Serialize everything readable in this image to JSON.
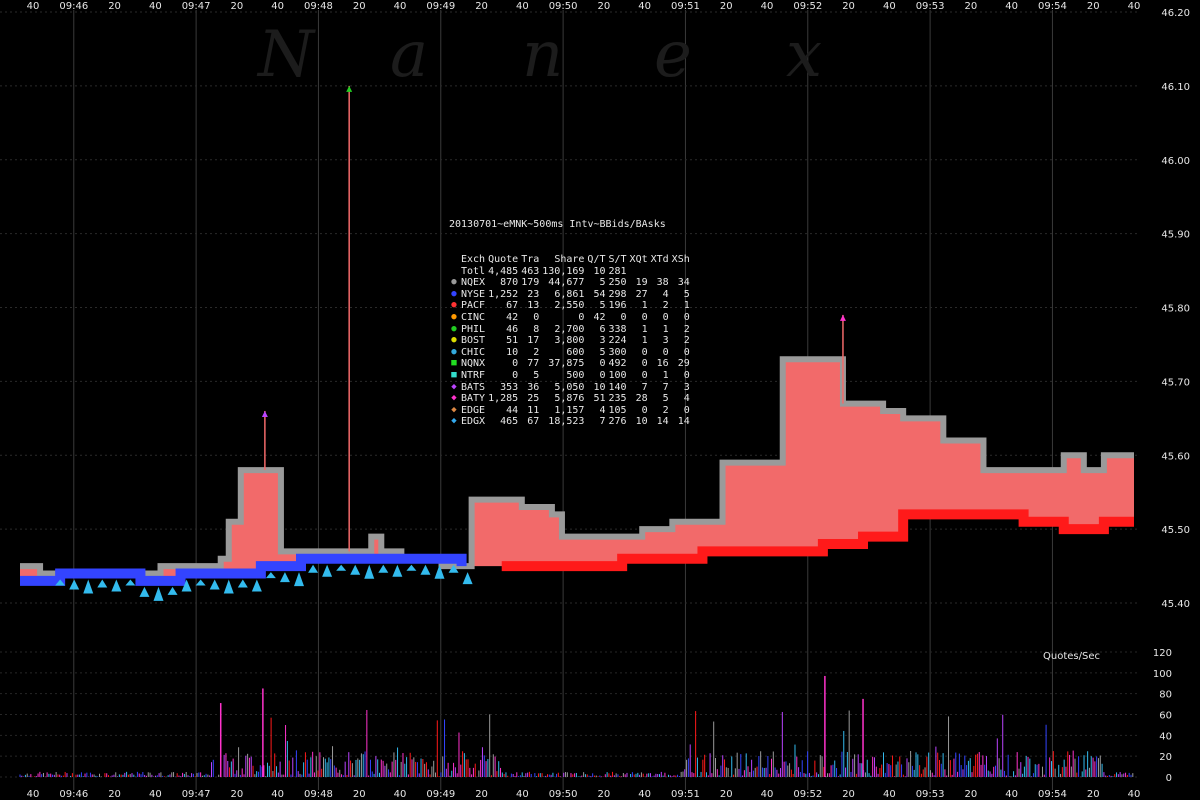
{
  "watermark": [
    "N",
    "a",
    "n",
    "e",
    "x"
  ],
  "top_axis_labels": [
    "40",
    "09:46",
    "20",
    "40",
    "09:47",
    "20",
    "40",
    "09:48",
    "20",
    "40",
    "09:49",
    "20",
    "40",
    "09:50",
    "20",
    "40",
    "09:51",
    "20",
    "40",
    "09:52",
    "20",
    "40",
    "09:53",
    "20",
    "40",
    "09:54",
    "20",
    "40"
  ],
  "bottom_axis_labels": [
    "40",
    "09:46",
    "20",
    "40",
    "09:47",
    "20",
    "40",
    "09:48",
    "20",
    "40",
    "09:49",
    "20",
    "40",
    "09:50",
    "20",
    "40",
    "09:51",
    "20",
    "40",
    "09:52",
    "20",
    "40",
    "09:53",
    "20",
    "40",
    "09:54",
    "20",
    "40"
  ],
  "stats": {
    "title": "20130701~eMNK~500ms Intv~BBids/BAsks",
    "headers": [
      "Exch",
      "Quote",
      "Tra",
      "Share",
      "Q/T",
      "S/T",
      "XQt",
      "XTd",
      "XSh"
    ],
    "rows": [
      {
        "sym": "",
        "color": "#e8e8e8",
        "cells": [
          "Totl",
          "4,485",
          "463",
          "130,169",
          "10",
          "281",
          "",
          "",
          ""
        ]
      },
      {
        "sym": "●",
        "color": "#9a9a9a",
        "cells": [
          "NQEX",
          "870",
          "179",
          "44,677",
          "5",
          "250",
          "19",
          "38",
          "34"
        ]
      },
      {
        "sym": "●",
        "color": "#3344ff",
        "cells": [
          "NYSE",
          "1,252",
          "23",
          "6,861",
          "54",
          "298",
          "27",
          "4",
          "5"
        ]
      },
      {
        "sym": "●",
        "color": "#ff3333",
        "cells": [
          "PACF",
          "67",
          "13",
          "2,550",
          "5",
          "196",
          "1",
          "2",
          "1"
        ]
      },
      {
        "sym": "●",
        "color": "#ff9900",
        "cells": [
          "CINC",
          "42",
          "0",
          "0",
          "42",
          "0",
          "0",
          "0",
          "0"
        ]
      },
      {
        "sym": "●",
        "color": "#22cc22",
        "cells": [
          "PHIL",
          "46",
          "8",
          "2,700",
          "6",
          "338",
          "1",
          "1",
          "2"
        ]
      },
      {
        "sym": "●",
        "color": "#dddd00",
        "cells": [
          "BOST",
          "51",
          "17",
          "3,800",
          "3",
          "224",
          "1",
          "3",
          "2"
        ]
      },
      {
        "sym": "●",
        "color": "#33aadd",
        "cells": [
          "CHIC",
          "10",
          "2",
          "600",
          "5",
          "300",
          "0",
          "0",
          "0"
        ]
      },
      {
        "sym": "■",
        "color": "#22dd22",
        "cells": [
          "NQNX",
          "0",
          "77",
          "37,875",
          "0",
          "492",
          "0",
          "16",
          "29"
        ]
      },
      {
        "sym": "■",
        "color": "#33ddcc",
        "cells": [
          "NTRF",
          "0",
          "5",
          "500",
          "0",
          "100",
          "0",
          "1",
          "0"
        ]
      },
      {
        "sym": "◆",
        "color": "#bb44ff",
        "cells": [
          "BATS",
          "353",
          "36",
          "5,050",
          "10",
          "140",
          "7",
          "7",
          "3"
        ]
      },
      {
        "sym": "◆",
        "color": "#ff33cc",
        "cells": [
          "BATY",
          "1,285",
          "25",
          "5,876",
          "51",
          "235",
          "28",
          "5",
          "4"
        ]
      },
      {
        "sym": "◆",
        "color": "#dd8844",
        "cells": [
          "EDGE",
          "44",
          "11",
          "1,157",
          "4",
          "105",
          "0",
          "2",
          "0"
        ]
      },
      {
        "sym": "◆",
        "color": "#33aaee",
        "cells": [
          "EDGX",
          "465",
          "67",
          "18,523",
          "7",
          "276",
          "10",
          "14",
          "14"
        ]
      }
    ]
  },
  "chart_data": [
    {
      "type": "area",
      "panel": "price",
      "ylim": [
        45.35,
        46.2
      ],
      "y_ticks": [
        "45.40",
        "45.50",
        "45.60",
        "45.70",
        "45.80",
        "45.90",
        "46.00",
        "46.10",
        "46.20"
      ],
      "y_tick_values": [
        45.4,
        45.5,
        45.6,
        45.7,
        45.8,
        45.9,
        46.0,
        46.1,
        46.2
      ],
      "xlim_seconds": [
        0,
        555
      ],
      "best_bid": [
        [
          0,
          45.43
        ],
        [
          10,
          45.43
        ],
        [
          20,
          45.44
        ],
        [
          40,
          45.44
        ],
        [
          60,
          45.43
        ],
        [
          80,
          45.44
        ],
        [
          100,
          45.44
        ],
        [
          120,
          45.45
        ],
        [
          140,
          45.46
        ],
        [
          160,
          45.46
        ],
        [
          180,
          45.46
        ],
        [
          200,
          45.46
        ],
        [
          220,
          45.45
        ],
        [
          240,
          45.45
        ],
        [
          260,
          45.45
        ],
        [
          280,
          45.45
        ],
        [
          300,
          45.46
        ],
        [
          320,
          45.46
        ],
        [
          340,
          45.47
        ],
        [
          360,
          45.47
        ],
        [
          380,
          45.47
        ],
        [
          400,
          45.48
        ],
        [
          420,
          45.49
        ],
        [
          440,
          45.52
        ],
        [
          460,
          45.52
        ],
        [
          480,
          45.52
        ],
        [
          500,
          45.51
        ],
        [
          520,
          45.5
        ],
        [
          540,
          45.51
        ],
        [
          555,
          45.51
        ]
      ],
      "best_ask": [
        [
          0,
          45.45
        ],
        [
          10,
          45.44
        ],
        [
          20,
          45.44
        ],
        [
          40,
          45.44
        ],
        [
          60,
          45.44
        ],
        [
          70,
          45.45
        ],
        [
          80,
          45.45
        ],
        [
          90,
          45.45
        ],
        [
          100,
          45.46
        ],
        [
          104,
          45.51
        ],
        [
          110,
          45.58
        ],
        [
          120,
          45.58
        ],
        [
          130,
          45.47
        ],
        [
          170,
          45.47
        ],
        [
          175,
          45.49
        ],
        [
          180,
          45.47
        ],
        [
          190,
          45.46
        ],
        [
          210,
          45.45
        ],
        [
          225,
          45.54
        ],
        [
          250,
          45.53
        ],
        [
          265,
          45.52
        ],
        [
          270,
          45.49
        ],
        [
          290,
          45.49
        ],
        [
          310,
          45.5
        ],
        [
          325,
          45.51
        ],
        [
          340,
          45.51
        ],
        [
          350,
          45.59
        ],
        [
          365,
          45.59
        ],
        [
          380,
          45.73
        ],
        [
          400,
          45.73
        ],
        [
          410,
          45.67
        ],
        [
          430,
          45.66
        ],
        [
          440,
          45.65
        ],
        [
          460,
          45.62
        ],
        [
          480,
          45.58
        ],
        [
          500,
          45.58
        ],
        [
          520,
          45.6
        ],
        [
          530,
          45.58
        ],
        [
          540,
          45.6
        ],
        [
          555,
          45.6
        ]
      ],
      "spikes": [
        {
          "exchange": "PHIL",
          "time_s": 164,
          "price": 46.1
        },
        {
          "exchange": "BATY",
          "time_s": 410,
          "price": 45.79
        },
        {
          "exchange": "BATS",
          "time_s": 122,
          "price": 45.66
        }
      ],
      "exchange_colors": {
        "NQEX": "#9a9a9a",
        "NYSE": "#3344ff",
        "PACF": "#ff1a1a",
        "BATS": "#bb44ff",
        "BATY": "#ff33cc",
        "EDGX": "#33bbee",
        "PHIL": "#22cc22",
        "spread_fill": "#f26a6a"
      }
    },
    {
      "type": "bar",
      "panel": "quote_rate",
      "ylabel": "Quotes/Sec",
      "ylim": [
        0,
        120
      ],
      "y_ticks": [
        "0",
        "20",
        "40",
        "60",
        "80",
        "100",
        "120"
      ],
      "y_tick_values": [
        0,
        20,
        40,
        60,
        80,
        100,
        120
      ],
      "peaks": [
        {
          "time_s": 401,
          "value": 97
        },
        {
          "time_s": 121,
          "value": 85
        },
        {
          "time_s": 100,
          "value": 71
        },
        {
          "time_s": 420,
          "value": 75
        }
      ],
      "typical_range": [
        0,
        25
      ]
    }
  ]
}
